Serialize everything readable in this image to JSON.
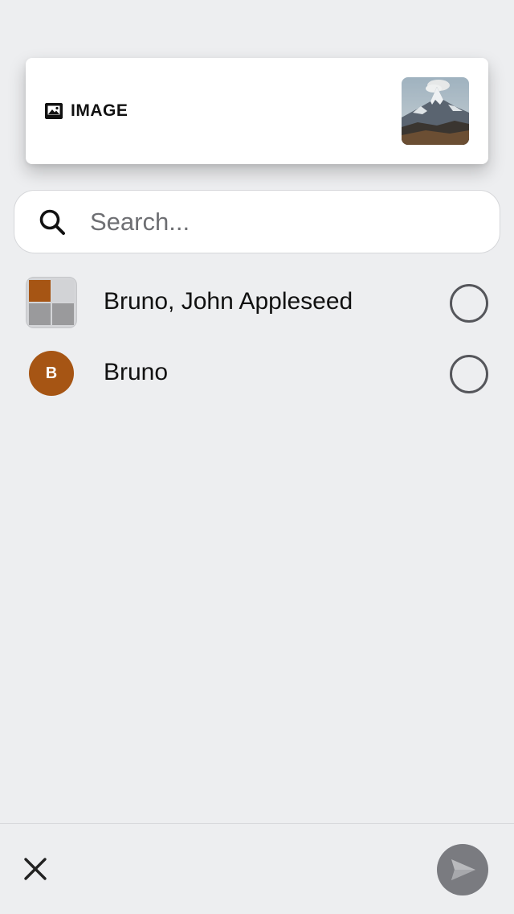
{
  "attachment": {
    "type_label": "IMAGE",
    "type_icon": "image-icon"
  },
  "search": {
    "placeholder": "Search...",
    "value": ""
  },
  "contacts": [
    {
      "name": "Bruno, John Appleseed",
      "avatar_type": "group",
      "selected": false
    },
    {
      "name": "Bruno",
      "avatar_type": "initial",
      "initial": "B",
      "avatar_color": "#a65514",
      "selected": false
    }
  ],
  "bottom_bar": {
    "close_icon": "close-icon",
    "send_icon": "send-icon"
  },
  "colors": {
    "background": "#edeef0",
    "accent_avatar": "#a65514",
    "send_button_disabled": "#7a7b80"
  }
}
